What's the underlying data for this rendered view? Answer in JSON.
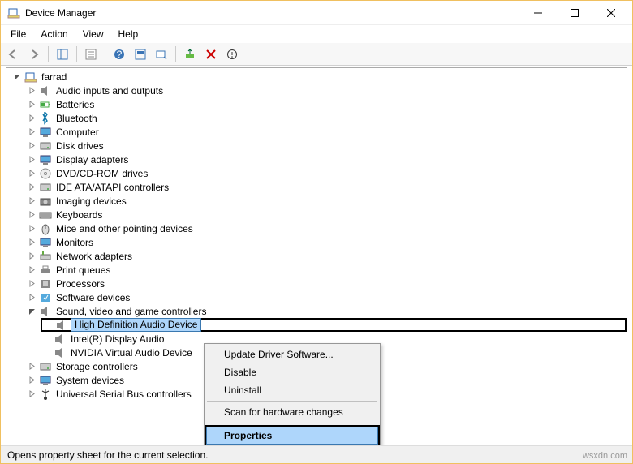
{
  "window": {
    "title": "Device Manager"
  },
  "menus": {
    "file": "File",
    "action": "Action",
    "view": "View",
    "help": "Help"
  },
  "root": {
    "name": "farrad"
  },
  "categories": [
    {
      "label": "Audio inputs and outputs",
      "icon": "speaker",
      "open": false
    },
    {
      "label": "Batteries",
      "icon": "battery",
      "open": false
    },
    {
      "label": "Bluetooth",
      "icon": "bluetooth",
      "open": false
    },
    {
      "label": "Computer",
      "icon": "monitor",
      "open": false
    },
    {
      "label": "Disk drives",
      "icon": "drive",
      "open": false
    },
    {
      "label": "Display adapters",
      "icon": "monitor",
      "open": false
    },
    {
      "label": "DVD/CD-ROM drives",
      "icon": "disc",
      "open": false
    },
    {
      "label": "IDE ATA/ATAPI controllers",
      "icon": "drive",
      "open": false
    },
    {
      "label": "Imaging devices",
      "icon": "camera",
      "open": false
    },
    {
      "label": "Keyboards",
      "icon": "keyboard",
      "open": false
    },
    {
      "label": "Mice and other pointing devices",
      "icon": "mouse",
      "open": false
    },
    {
      "label": "Monitors",
      "icon": "monitor",
      "open": false
    },
    {
      "label": "Network adapters",
      "icon": "net",
      "open": false
    },
    {
      "label": "Print queues",
      "icon": "printer",
      "open": false
    },
    {
      "label": "Processors",
      "icon": "cpu",
      "open": false
    },
    {
      "label": "Software devices",
      "icon": "soft",
      "open": false
    },
    {
      "label": "Sound, video and game controllers",
      "icon": "speaker",
      "open": true,
      "children": [
        {
          "label": "High Definition Audio Device",
          "icon": "speaker",
          "selected": true
        },
        {
          "label": "Intel(R) Display Audio",
          "icon": "speaker"
        },
        {
          "label": "NVIDIA Virtual Audio Device",
          "icon": "speaker"
        }
      ]
    },
    {
      "label": "Storage controllers",
      "icon": "drive",
      "open": false
    },
    {
      "label": "System devices",
      "icon": "monitor",
      "open": false
    },
    {
      "label": "Universal Serial Bus controllers",
      "icon": "usb",
      "open": false
    }
  ],
  "context_menu": {
    "items": [
      "Update Driver Software...",
      "Disable",
      "Uninstall",
      "-",
      "Scan for hardware changes",
      "-",
      "Properties"
    ],
    "highlighted": "Properties"
  },
  "status": {
    "text": "Opens property sheet for the current selection."
  },
  "watermark": "wsxdn.com"
}
